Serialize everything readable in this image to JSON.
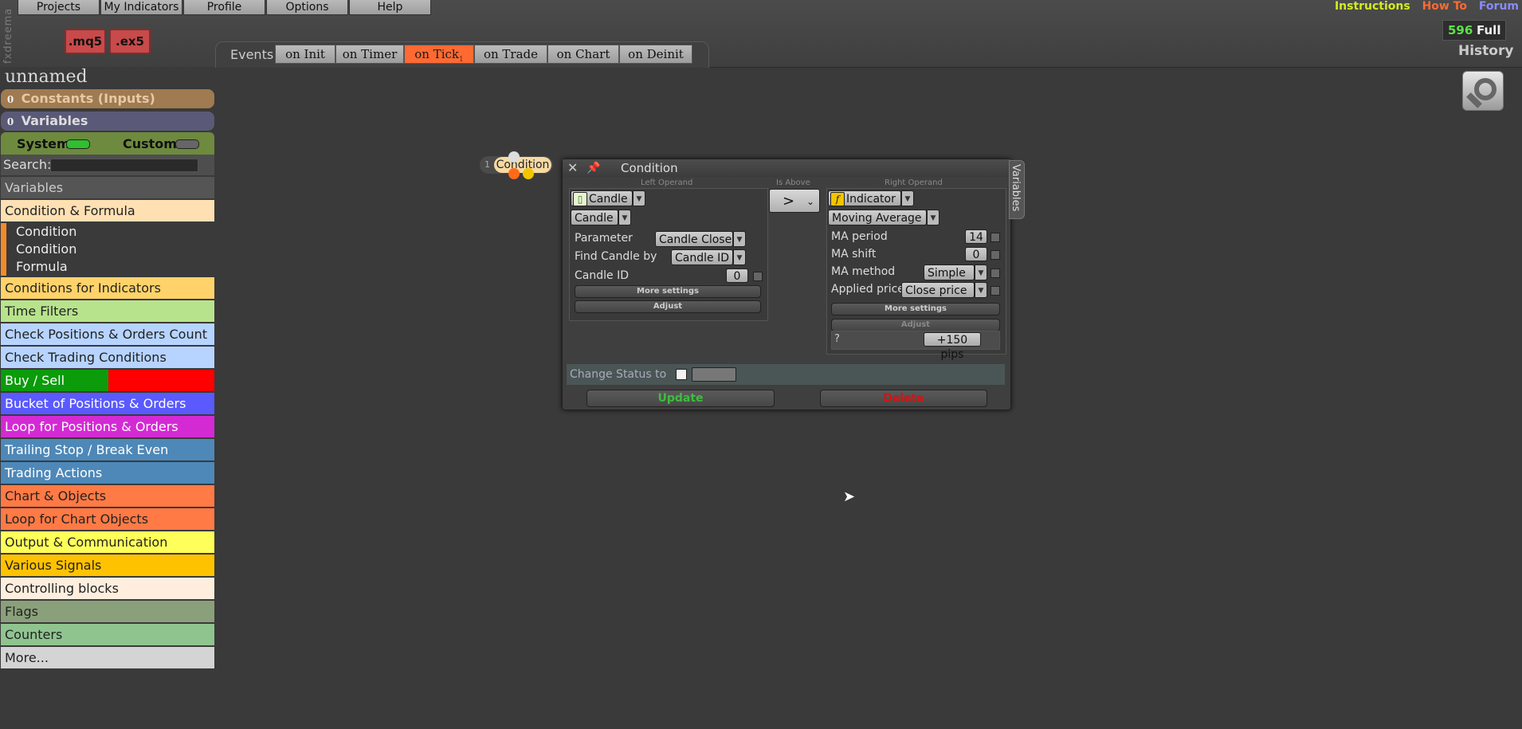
{
  "app": {
    "vertical_logo": "fxdreema",
    "menu": [
      "Projects",
      "My Indicators",
      "Profile",
      "Options",
      "Help"
    ],
    "file_buttons": [
      ".mq5",
      ".ex5"
    ],
    "top_links": {
      "instructions": "Instructions",
      "howto": "How To",
      "forum": "Forum"
    },
    "counter": "596",
    "plan": "Full",
    "history": "History",
    "colors": {
      "instructions": "#d4ec1e",
      "howto": "#ff6a33",
      "forum": "#8a8aff",
      "accent_active": "#ff6a33"
    }
  },
  "events": {
    "label": "Events",
    "tabs": [
      {
        "label": "on Init"
      },
      {
        "label": "on Timer"
      },
      {
        "label": "on Tick",
        "badge": "1",
        "active": true
      },
      {
        "label": "on Trade"
      },
      {
        "label": "on Chart"
      },
      {
        "label": "on Deinit"
      }
    ]
  },
  "sidebar": {
    "project_name": "unnamed",
    "constants": {
      "count": "0",
      "label": "Constants (Inputs)"
    },
    "variables": {
      "count": "0",
      "label": "Variables"
    },
    "system_label": "System",
    "custom_label": "Custom",
    "search_label": "Search:",
    "search_value": "",
    "variables_header": "Variables",
    "categories": [
      {
        "label": "Condition & Formula",
        "bg": "#ffe0b3",
        "fg": "#222"
      },
      {
        "label": "Conditions for Indicators",
        "bg": "#ffd36a",
        "fg": "#222"
      },
      {
        "label": "Time Filters",
        "bg": "#b8e38d",
        "fg": "#222"
      },
      {
        "label": "Check Positions & Orders Count",
        "bg": "#b6d4ff",
        "fg": "#222"
      },
      {
        "label": "Check Trading Conditions",
        "bg": "#b6d4ff",
        "fg": "#222"
      },
      {
        "label": "Buy / Sell",
        "bg": "#0b9b0b",
        "fg": "#fff"
      },
      {
        "label": "Bucket of Positions & Orders",
        "bg": "#5a5aff",
        "fg": "#fff"
      },
      {
        "label": "Loop for Positions & Orders",
        "bg": "#d42ad4",
        "fg": "#fff"
      },
      {
        "label": "Trailing Stop / Break Even",
        "bg": "#4e88b8",
        "fg": "#fff"
      },
      {
        "label": "Trading Actions",
        "bg": "#4e88b8",
        "fg": "#fff"
      },
      {
        "label": "Chart & Objects",
        "bg": "#ff7a45",
        "fg": "#222"
      },
      {
        "label": "Loop for Chart Objects",
        "bg": "#ff7a45",
        "fg": "#222"
      },
      {
        "label": "Output & Communication",
        "bg": "#ffff5a",
        "fg": "#222"
      },
      {
        "label": "Various Signals",
        "bg": "#ffc200",
        "fg": "#222"
      },
      {
        "label": "Controlling blocks",
        "bg": "#ffeede",
        "fg": "#222"
      },
      {
        "label": "Flags",
        "bg": "#8aa07a",
        "fg": "#222"
      },
      {
        "label": "Counters",
        "bg": "#8fc48f",
        "fg": "#222"
      },
      {
        "label": "More...",
        "bg": "#d4d4d4",
        "fg": "#222"
      }
    ],
    "subitems": [
      "Condition",
      "Condition",
      "Formula"
    ]
  },
  "block": {
    "number": "1",
    "label": "Condition"
  },
  "dialog": {
    "title": "Condition",
    "variables_tab": "Variables",
    "left_operand_label": "Left Operand",
    "comparator_label": "Is Above",
    "right_operand_label": "Right Operand",
    "comparator": ">",
    "left": {
      "type": "Candle",
      "subtype": "Candle",
      "parameter_label": "Parameter",
      "parameter_value": "Candle Close",
      "find_label": "Find Candle by",
      "find_value": "Candle ID",
      "id_label": "Candle ID",
      "id_value": "0",
      "more_settings": "More settings",
      "adjust": "Adjust"
    },
    "right": {
      "type": "Indicator",
      "subtype": "Moving Average",
      "period_label": "MA period",
      "period_value": "14",
      "shift_label": "MA shift",
      "shift_value": "0",
      "method_label": "MA method",
      "method_value": "Simple",
      "applied_label": "Applied price",
      "applied_value": "Close price",
      "more_settings": "More settings",
      "adjust": "Adjust",
      "adjust_help": "?",
      "adjust_value": "+150 pips"
    },
    "status_label": "Change Status to",
    "update": "Update",
    "delete": "Delete"
  }
}
